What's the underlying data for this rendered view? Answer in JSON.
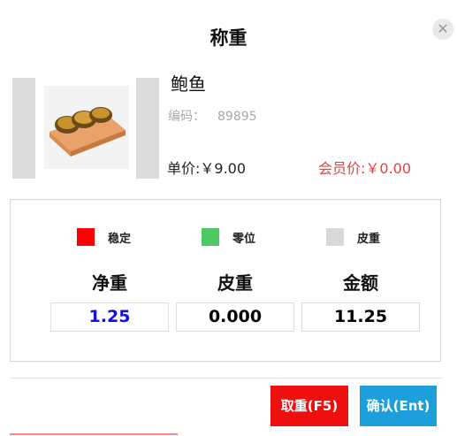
{
  "dialog": {
    "title": "称重",
    "close_icon": "close-icon"
  },
  "product": {
    "name": "鲍鱼",
    "code_label": "编码：",
    "code_value": "89895",
    "unit_price": "单价:￥9.00",
    "member_price": "会员价:￥0.00",
    "image_icon": "abalone-product-image"
  },
  "legend": [
    {
      "label": "稳定",
      "color": "#ff0000"
    },
    {
      "label": "零位",
      "color": "#4cc963"
    },
    {
      "label": "皮重",
      "color": "#d9d9d9"
    }
  ],
  "readings": {
    "net_weight": {
      "label": "净重",
      "value": "1.25",
      "color": "#1010e0"
    },
    "tare": {
      "label": "皮重",
      "value": "0.000",
      "color": "#000000"
    },
    "amount": {
      "label": "金额",
      "value": "11.25",
      "color": "#000000"
    }
  },
  "buttons": {
    "reweigh": "取重(F5)",
    "confirm": "确认(Ent)"
  },
  "colors": {
    "accent_red": "#ee0f0f",
    "accent_blue": "#1d9fdb",
    "vip_price": "#e04444"
  }
}
